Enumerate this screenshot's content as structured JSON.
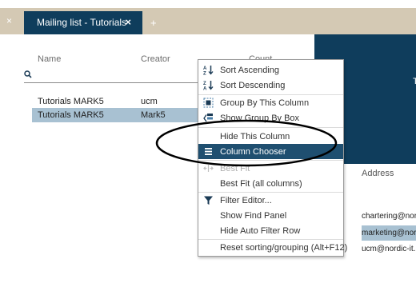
{
  "tabs": {
    "active_label": "Mailing list - Tutorials",
    "active_close": "×",
    "left_close": "×",
    "add_label": "+"
  },
  "grid": {
    "columns": [
      "Name",
      "Creator",
      "Count"
    ],
    "rows": [
      {
        "name": "Tutorials MARK5",
        "creator": "ucm",
        "selected": false
      },
      {
        "name": "Tutorials MARK5",
        "creator": "Mark5",
        "selected": true
      }
    ]
  },
  "right_panel": {
    "header_letter": "T",
    "address_label": "Address",
    "emails": [
      {
        "text": "chartering@nor",
        "selected": false
      },
      {
        "text": "marketing@nor",
        "selected": true
      },
      {
        "text": "ucm@nordic-it.",
        "selected": false
      }
    ]
  },
  "context_menu": {
    "items": [
      {
        "label": "Sort Ascending",
        "icon": "sort-ascending-icon",
        "state": "normal"
      },
      {
        "label": "Sort Descending",
        "icon": "sort-descending-icon",
        "state": "normal"
      },
      {
        "label": "Group By This Column",
        "icon": "group-by-icon",
        "state": "normal"
      },
      {
        "label": "Show Group By Box",
        "icon": "group-by-box-icon",
        "state": "normal"
      },
      {
        "label": "Hide This Column",
        "icon": "",
        "state": "normal"
      },
      {
        "label": "Column Chooser",
        "icon": "column-chooser-icon",
        "state": "highlighted"
      },
      {
        "label": "Best Fit",
        "icon": "best-fit-icon",
        "state": "disabled"
      },
      {
        "label": "Best Fit (all columns)",
        "icon": "",
        "state": "normal"
      },
      {
        "label": "Filter Editor...",
        "icon": "filter-icon",
        "state": "normal"
      },
      {
        "label": "Show Find Panel",
        "icon": "",
        "state": "normal"
      },
      {
        "label": "Hide Auto Filter Row",
        "icon": "",
        "state": "normal"
      },
      {
        "label": "Reset sorting/grouping (Alt+F12)",
        "icon": "",
        "state": "normal"
      }
    ]
  },
  "colors": {
    "tab_strip": "#d4c9b4",
    "accent_dark": "#0f3d5c",
    "selection": "#a8c1d2",
    "menu_highlight": "#1f4f70"
  }
}
